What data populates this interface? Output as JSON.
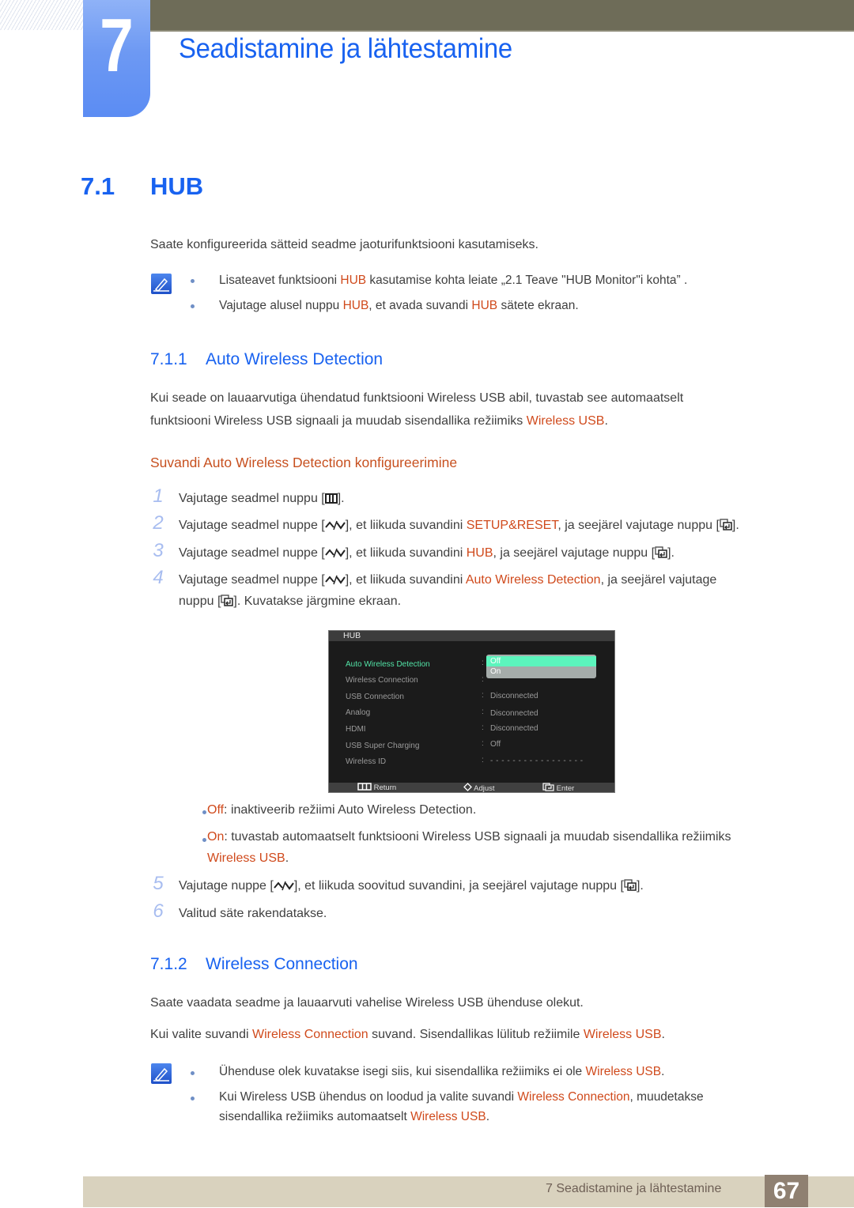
{
  "chapter": {
    "number": "7",
    "title": "Seadistamine ja lähtestamine"
  },
  "section": {
    "number": "7.1",
    "title": "HUB",
    "intro": "Saate konfigureerida sätteid seadme jaoturifunktsiooni kasutamiseks.",
    "notes": [
      {
        "parts": [
          "Lisateavet funktsiooni ",
          "HUB",
          " kasutamise kohta leiate „2.1 Teave \"HUB Monitor\"i kohta” ."
        ]
      },
      {
        "parts": [
          "Vajutage alusel nuppu ",
          "HUB",
          ", et avada suvandi ",
          "HUB",
          " sätete ekraan."
        ]
      }
    ]
  },
  "subsection1": {
    "number": "7.1.1",
    "title": "Auto Wireless Detection",
    "para_line1": "Kui seade on lauaarvutiga ühendatud funktsiooni Wireless USB abil, tuvastab see automaatselt",
    "para_line2_a": "funktsiooni Wireless USB signaali ja muudab sisendallika režiimiks ",
    "para_line2_hl": "Wireless USB",
    "para_line2_b": ".",
    "howto_title": "Suvandi Auto Wireless Detection konfigureerimine",
    "steps": [
      {
        "num": "1",
        "a": "Vajutage seadmel nuppu [",
        "b": "]."
      },
      {
        "num": "2",
        "a": "Vajutage seadmel nuppe [",
        "b": "], et liikuda suvandini ",
        "hl": "SETUP&RESET",
        "c": ", ja seejärel vajutage nuppu [",
        "d": "]."
      },
      {
        "num": "3",
        "a": "Vajutage seadmel nuppe [",
        "b": "], et liikuda suvandini ",
        "hl": "HUB",
        "c": ", ja seejärel vajutage nuppu [",
        "d": "]."
      },
      {
        "num": "4",
        "a": "Vajutage seadmel nuppe [",
        "b": "], et liikuda suvandini ",
        "hl": "Auto Wireless Detection",
        "c": ", ja seejärel vajutage",
        "line2a": "nuppu [",
        "line2b": "]. Kuvatakse järgmine ekraan."
      },
      {
        "num": "5",
        "a": "Vajutage nuppe [",
        "b": "], et liikuda soovitud suvandini, ja seejärel vajutage nuppu [",
        "c": "]."
      },
      {
        "num": "6",
        "a": "Valitud säte rakendatakse."
      }
    ],
    "options": [
      {
        "label": "Off",
        "desc": ": inaktiveerib režiimi Auto Wireless Detection."
      },
      {
        "label": "On",
        "desc": ": tuvastab automaatselt funktsiooni Wireless USB signaali ja muudab sisendallika režiimiks",
        "desc2": "Wireless USB",
        "desc3": "."
      }
    ]
  },
  "osd": {
    "title": "HUB",
    "rows": [
      {
        "label": "Auto Wireless Detection",
        "value": ""
      },
      {
        "label": "Wireless Connection",
        "value": ""
      },
      {
        "label": "USB Connection",
        "value": "Disconnected"
      },
      {
        "label": "Analog",
        "value": "Disconnected"
      },
      {
        "label": "HDMI",
        "value": "Disconnected"
      },
      {
        "label": "USB Super Charging",
        "value": "Off"
      },
      {
        "label": "Wireless ID",
        "value": "- - - - - - - - - - - - - - - - -"
      }
    ],
    "dropdown": {
      "options": [
        "Off",
        "On"
      ],
      "selected": "Off"
    },
    "footer": {
      "return": "Return",
      "adjust": "Adjust",
      "enter": "Enter"
    },
    "colors": {
      "active": "#52e3a6",
      "selected_bg": "#5cf5bd"
    }
  },
  "subsection2": {
    "number": "7.1.2",
    "title": "Wireless Connection",
    "para1": "Saate vaadata seadme ja lauaarvuti vahelise Wireless USB ühenduse olekut.",
    "para2": [
      "Kui valite suvandi ",
      "Wireless Connection",
      " suvand. Sisendallikas lülitub režiimile ",
      "Wireless USB",
      "."
    ],
    "notes": [
      {
        "parts": [
          "Ühenduse olek kuvatakse isegi siis, kui sisendallika režiimiks ei ole ",
          "Wireless USB",
          "."
        ]
      },
      {
        "parts": [
          "Kui Wireless USB ühendus on loodud ja valite suvandi ",
          "Wireless Connection",
          ", muudetakse"
        ],
        "line2": [
          "sisendallika režiimiks automaatselt ",
          "Wireless USB",
          "."
        ]
      }
    ]
  },
  "footer": {
    "chapter_label": "7 Seadistamine ja lähtestamine",
    "page_number": "67"
  },
  "colors": {
    "heading_blue": "#1862f0",
    "highlight_orange": "#d04a1c",
    "topbar": "#6e6c58",
    "footer_bar": "#d9d2be",
    "page_box": "#8f8071"
  }
}
